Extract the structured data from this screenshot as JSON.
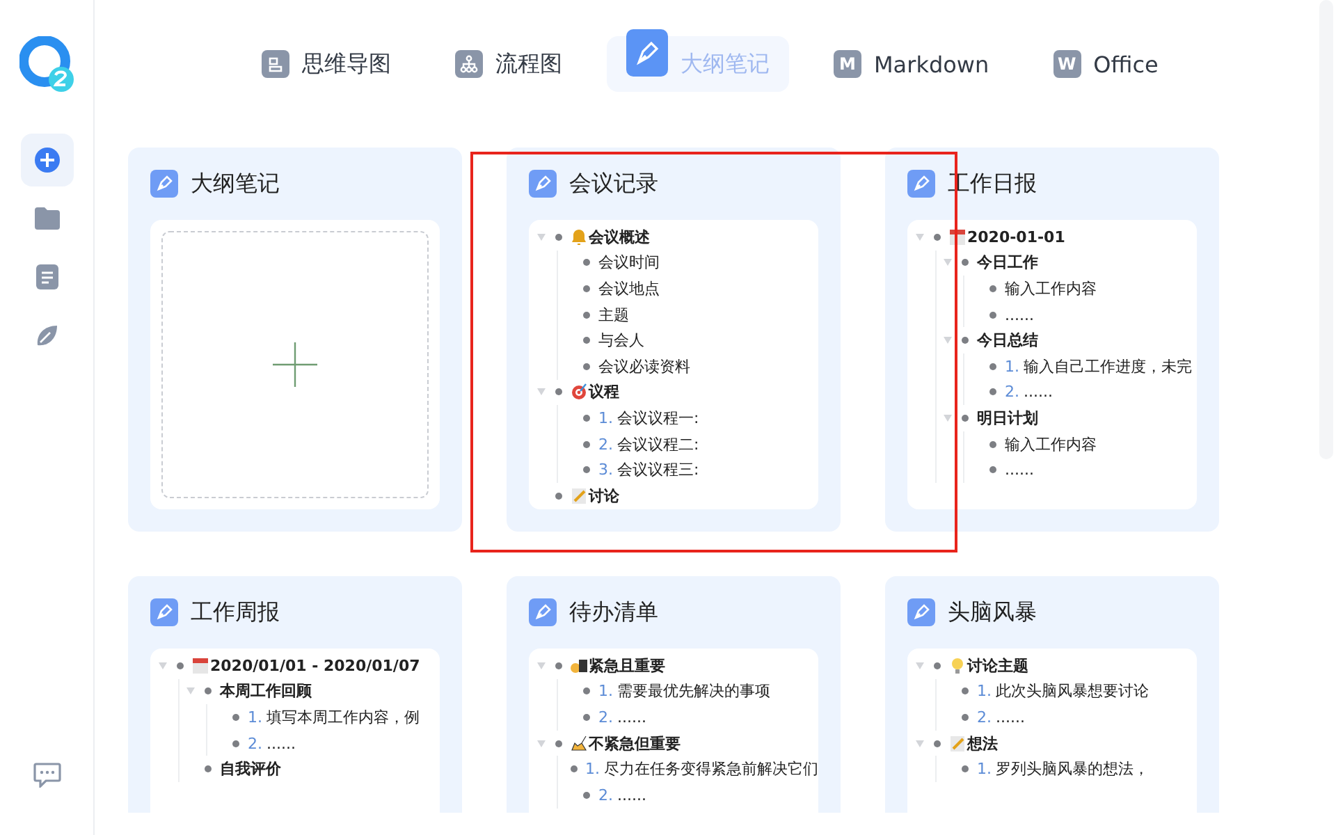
{
  "tabs": [
    {
      "label": "思维导图",
      "selected": false
    },
    {
      "label": "流程图",
      "selected": false
    },
    {
      "label": "大纲笔记",
      "selected": true
    },
    {
      "label": "Markdown",
      "badge": "M",
      "selected": false
    },
    {
      "label": "Office",
      "badge": "W",
      "selected": false
    }
  ],
  "sidebar": {
    "items": [
      {
        "selected": true
      },
      {
        "selected": false
      },
      {
        "selected": false
      },
      {
        "selected": false
      }
    ]
  },
  "cards": [
    {
      "title": "大纲笔记",
      "kind": "new",
      "highlighted": false
    },
    {
      "title": "会议记录",
      "kind": "outline",
      "highlighted": true,
      "outline": [
        {
          "kind": "heading",
          "text": "会议概述",
          "children": [
            {
              "kind": "item",
              "text": "会议时间"
            },
            {
              "kind": "item",
              "text": "会议地点"
            },
            {
              "kind": "item",
              "text": "主题"
            },
            {
              "kind": "item",
              "text": "与会人"
            },
            {
              "kind": "item",
              "text": "会议必读资料"
            }
          ]
        },
        {
          "kind": "heading",
          "text": "议程",
          "children": [
            {
              "kind": "item",
              "num": "1.",
              "text": "会议议程一:"
            },
            {
              "kind": "item",
              "num": "2.",
              "text": "会议议程二:"
            },
            {
              "kind": "item",
              "num": "3.",
              "text": "会议议程三:"
            }
          ]
        },
        {
          "kind": "heading",
          "text": "讨论"
        }
      ]
    },
    {
      "title": "工作日报",
      "kind": "outline",
      "highlighted": false,
      "outline": [
        {
          "kind": "heading",
          "text": "2020-01-01",
          "children": [
            {
              "kind": "heading",
              "text": "今日工作",
              "children": [
                {
                  "kind": "item",
                  "text": "输入工作内容"
                },
                {
                  "kind": "item",
                  "text": "......"
                }
              ]
            },
            {
              "kind": "heading",
              "text": "今日总结",
              "children": [
                {
                  "kind": "item",
                  "num": "1.",
                  "text": "输入自己工作进度，未完"
                },
                {
                  "kind": "item",
                  "num": "2.",
                  "text": "......"
                }
              ]
            },
            {
              "kind": "heading",
              "text": "明日计划",
              "children": [
                {
                  "kind": "item",
                  "text": "输入工作内容"
                },
                {
                  "kind": "item",
                  "text": "......"
                }
              ]
            }
          ]
        }
      ]
    },
    {
      "title": "工作周报",
      "kind": "outline",
      "highlighted": false,
      "outline": [
        {
          "kind": "heading",
          "text": "2020/01/01 - 2020/01/07",
          "children": [
            {
              "kind": "heading",
              "text": "本周工作回顾",
              "children": [
                {
                  "kind": "item",
                  "num": "1.",
                  "text": "填写本周工作内容，例"
                },
                {
                  "kind": "item",
                  "num": "2.",
                  "text": "......"
                }
              ]
            },
            {
              "kind": "heading",
              "text": "自我评价"
            }
          ]
        }
      ]
    },
    {
      "title": "待办清单",
      "kind": "outline",
      "highlighted": false,
      "outline": [
        {
          "kind": "heading",
          "text": "紧急且重要",
          "children": [
            {
              "kind": "item",
              "num": "1.",
              "text": "需要最优先解决的事项"
            },
            {
              "kind": "item",
              "num": "2.",
              "text": "......"
            }
          ]
        },
        {
          "kind": "heading",
          "text": "不紧急但重要",
          "children": [
            {
              "kind": "item",
              "num": "1.",
              "text": "尽力在任务变得紧急前解决它们"
            },
            {
              "kind": "item",
              "num": "2.",
              "text": "......"
            }
          ]
        }
      ]
    },
    {
      "title": "头脑风暴",
      "kind": "outline",
      "highlighted": false,
      "outline": [
        {
          "kind": "heading",
          "text": "讨论主题",
          "children": [
            {
              "kind": "item",
              "num": "1.",
              "text": "此次头脑风暴想要讨论"
            },
            {
              "kind": "item",
              "num": "2.",
              "text": "......"
            }
          ]
        },
        {
          "kind": "heading",
          "text": "想法",
          "children": [
            {
              "kind": "item",
              "num": "1.",
              "text": "罗列头脑风暴的想法，"
            }
          ]
        }
      ]
    }
  ]
}
